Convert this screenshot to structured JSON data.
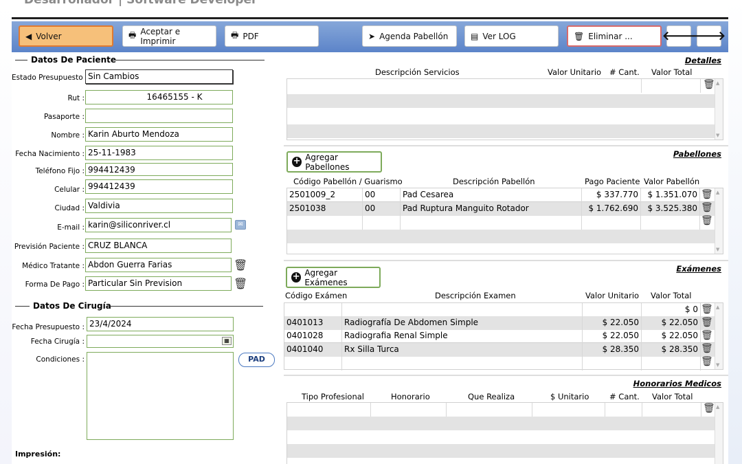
{
  "title": "Desarrollador | Software Developer",
  "toolbar": {
    "volver": "Volver",
    "aceptar": "Aceptar e Imprimir",
    "pdf": "PDF",
    "agenda": "Agenda Pabellón",
    "log": "Ver LOG",
    "eliminar": "Eliminar ...",
    "prev": "🡐",
    "next": "🡒"
  },
  "paciente": {
    "section_title": "Datos De Paciente",
    "labels": {
      "estado": "Estado Presupuesto :",
      "rut": "Rut :",
      "pasaporte": "Pasaporte :",
      "nombre": "Nombre :",
      "fecha_nac": "Fecha Nacimiento :",
      "telefono": "Teléfono Fijo :",
      "celular": "Celular :",
      "ciudad": "Ciudad :",
      "email": "E-mail :",
      "prevision": "Previsión Paciente :",
      "medico": "Médico Tratante :",
      "forma_pago": "Forma De Pago :"
    },
    "values": {
      "estado": "Sin Cambios",
      "rut": "16465155 -      K",
      "pasaporte": "",
      "nombre": "Karin Aburto Mendoza",
      "fecha_nac": "25-11-1983",
      "telefono": "994412439",
      "celular": "994412439",
      "ciudad": "Valdivia",
      "email": "karin@siliconriver.cl",
      "prevision": "CRUZ BLANCA",
      "medico": "Abdon Guerra Farias",
      "forma_pago": "Particular Sin Prevision"
    }
  },
  "cirugia": {
    "section_title": "Datos De Cirugía",
    "labels": {
      "fecha_presupuesto": "Fecha Presupuesto :",
      "fecha_cirugia": "Fecha Cirugía :",
      "condiciones": "Condiciones :"
    },
    "values": {
      "fecha_presupuesto": "23/4/2024",
      "fecha_cirugia": "",
      "condiciones": ""
    },
    "pad_button": "PAD",
    "impresion": "Impresión:"
  },
  "detalles": {
    "title": "Detalles",
    "headers": [
      "Descripción Servicios",
      "Valor Unitario",
      "# Cant.",
      "Valor Total"
    ]
  },
  "pabellones": {
    "title": "Pabellones",
    "add_button": "Agregar Pabellones",
    "headers": [
      "Código Pabellón / Guarismo",
      "Descripción Pabellón",
      "Pago Paciente",
      "Valor Pabellón"
    ],
    "rows": [
      {
        "codigo": "2501009_2",
        "guarismo": "00",
        "descripcion": "Pad Cesarea",
        "pago": "$ 337.770",
        "valor": "$ 1.351.070"
      },
      {
        "codigo": "2501038",
        "guarismo": "00",
        "descripcion": "Pad Ruptura Manguito Rotador",
        "pago": "$ 1.762.690",
        "valor": "$ 3.525.380"
      }
    ]
  },
  "examenes": {
    "title": "Exámenes",
    "add_button": "Agregar Exámenes",
    "headers": [
      "Código Exámen",
      "Descripción Examen",
      "Valor Unitario",
      "Valor Total"
    ],
    "first_total": "$ 0",
    "rows": [
      {
        "codigo": "0401013",
        "descripcion": "Radiografía De Abdomen Simple",
        "unitario": "$ 22.050",
        "total": "$ 22.050"
      },
      {
        "codigo": "0401028",
        "descripcion": "Radiografia Renal Simple",
        "unitario": "$ 22.050",
        "total": "$ 22.050"
      },
      {
        "codigo": "0401040",
        "descripcion": "Rx Silla Turca",
        "unitario": "$ 28.350",
        "total": "$ 28.350"
      }
    ]
  },
  "honorarios": {
    "title": "Honorarios Medicos",
    "headers": [
      "Tipo Profesional",
      "Honorario",
      "Que Realiza",
      "$ Unitario",
      "# Cant.",
      "Valor Total"
    ]
  },
  "icons": {
    "trash": "trash-icon",
    "printer": "printer-icon",
    "calendar": "calendar-icon",
    "mail": "mail-icon"
  },
  "colors": {
    "toolbar": "#6d92d0",
    "volver_bg": "#f6c07a",
    "field_border": "#7daa5a",
    "eliminar_border": "#d86a6a"
  }
}
